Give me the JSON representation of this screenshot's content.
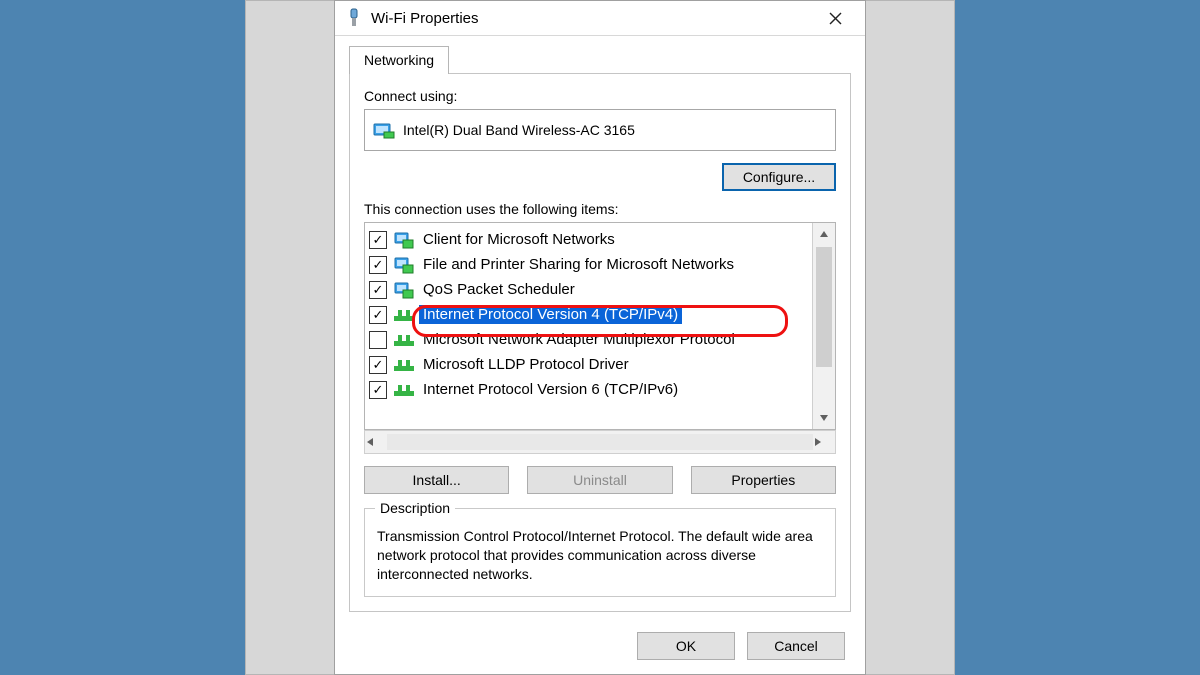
{
  "window": {
    "title": "Wi-Fi Properties"
  },
  "tab": {
    "label": "Networking"
  },
  "connect_using_label": "Connect using:",
  "adapter": {
    "name": "Intel(R) Dual Band Wireless-AC 3165"
  },
  "configure_label": "Configure...",
  "items_label": "This connection uses the following items:",
  "components": [
    {
      "checked": true,
      "icon": "client",
      "label": "Client for Microsoft Networks"
    },
    {
      "checked": true,
      "icon": "service",
      "label": "File and Printer Sharing for Microsoft Networks"
    },
    {
      "checked": true,
      "icon": "service",
      "label": "QoS Packet Scheduler"
    },
    {
      "checked": true,
      "icon": "protocol",
      "label": "Internet Protocol Version 4 (TCP/IPv4)",
      "selected": true,
      "highlighted": true
    },
    {
      "checked": false,
      "icon": "protocol",
      "label": "Microsoft Network Adapter Multiplexor Protocol"
    },
    {
      "checked": true,
      "icon": "protocol",
      "label": "Microsoft LLDP Protocol Driver"
    },
    {
      "checked": true,
      "icon": "protocol",
      "label": "Internet Protocol Version 6 (TCP/IPv6)"
    }
  ],
  "buttons": {
    "install": "Install...",
    "uninstall": "Uninstall",
    "properties": "Properties",
    "ok": "OK",
    "cancel": "Cancel"
  },
  "description": {
    "legend": "Description",
    "text": "Transmission Control Protocol/Internet Protocol. The default wide area network protocol that provides communication across diverse interconnected networks."
  }
}
